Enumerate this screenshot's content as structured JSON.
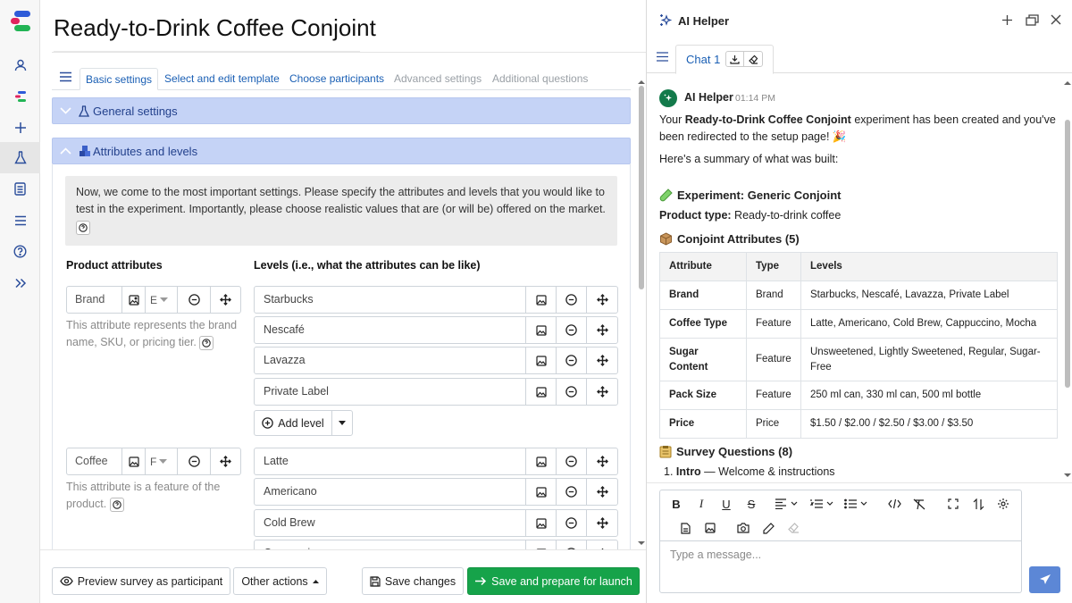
{
  "rail": {
    "items": [
      "logo",
      "user-icon",
      "brand-icon",
      "plus-icon",
      "flask-icon",
      "document-icon",
      "list-icon",
      "help-icon",
      "expand-icon"
    ]
  },
  "main": {
    "title": "Ready-to-Drink Coffee Conjoint",
    "tabs": [
      {
        "label": "Basic settings",
        "state": "active"
      },
      {
        "label": "Select and edit template",
        "state": "link"
      },
      {
        "label": "Choose participants",
        "state": "link"
      },
      {
        "label": "Advanced settings",
        "state": "disabled"
      },
      {
        "label": "Additional questions",
        "state": "disabled"
      }
    ],
    "general_settings_label": "General settings",
    "attributes_label": "Attributes and levels",
    "intro_text": "Now, we come to the most important settings. Please specify the attributes and levels that you would like to test in the experiment. Importantly, please choose realistic values that are (or will be) offered on the market.",
    "product_attributes_heading": "Product attributes",
    "levels_heading": "Levels (i.e., what the attributes can be like)",
    "attributes": [
      {
        "name": "Brand",
        "type_short": "E",
        "description": "This attribute represents the brand name, SKU, or pricing tier.",
        "levels": [
          "Starbucks",
          "Nescafé",
          "Lavazza",
          "Private Label"
        ]
      },
      {
        "name": "Coffee",
        "type_short": "F",
        "description": "This attribute is a feature of the product.",
        "levels": [
          "Latte",
          "Americano",
          "Cold Brew",
          "Cappuccino"
        ]
      }
    ],
    "add_level_label": "Add level",
    "footer": {
      "preview": "Preview survey as participant",
      "other_actions": "Other actions",
      "save": "Save changes",
      "launch": "Save and prepare for launch"
    }
  },
  "panel": {
    "title": "AI Helper",
    "chat_tab": "Chat 1",
    "message": {
      "sender": "AI Helper",
      "time": "01:14 PM",
      "p1_pre": "Your ",
      "p1_bold": "Ready-to-Drink Coffee Conjoint",
      "p1_post": " experiment has been created and you've been redirected to the setup page! 🎉",
      "p2": "Here's a summary of what was built:",
      "experiment_heading": "Experiment: Generic Conjoint",
      "product_type_label": "Product type:",
      "product_type_value": " Ready-to-drink coffee",
      "attributes_heading": "Conjoint Attributes (5)",
      "table_headers": [
        "Attribute",
        "Type",
        "Levels"
      ],
      "table_rows": [
        [
          "Brand",
          "Brand",
          "Starbucks, Nescafé, Lavazza, Private Label"
        ],
        [
          "Coffee Type",
          "Feature",
          "Latte, Americano, Cold Brew, Cappuccino, Mocha"
        ],
        [
          "Sugar Content",
          "Feature",
          "Unsweetened, Lightly Sweetened, Regular, Sugar-Free"
        ],
        [
          "Pack Size",
          "Feature",
          "250 ml can, 330 ml can, 500 ml bottle"
        ],
        [
          "Price",
          "Price",
          "$1.50 / $2.00 / $2.50 / $3.00 / $3.50"
        ]
      ],
      "survey_heading": "Survey Questions (8)",
      "survey_item_num": "1.",
      "survey_item_bold": "Intro",
      "survey_item_rest": " — Welcome & instructions"
    },
    "input_placeholder": "Type a message..."
  },
  "colors": {
    "accent": "#1a5fb4",
    "accordion": "#c5d3f6",
    "launch": "#16a34a",
    "send": "#5c87d6"
  }
}
